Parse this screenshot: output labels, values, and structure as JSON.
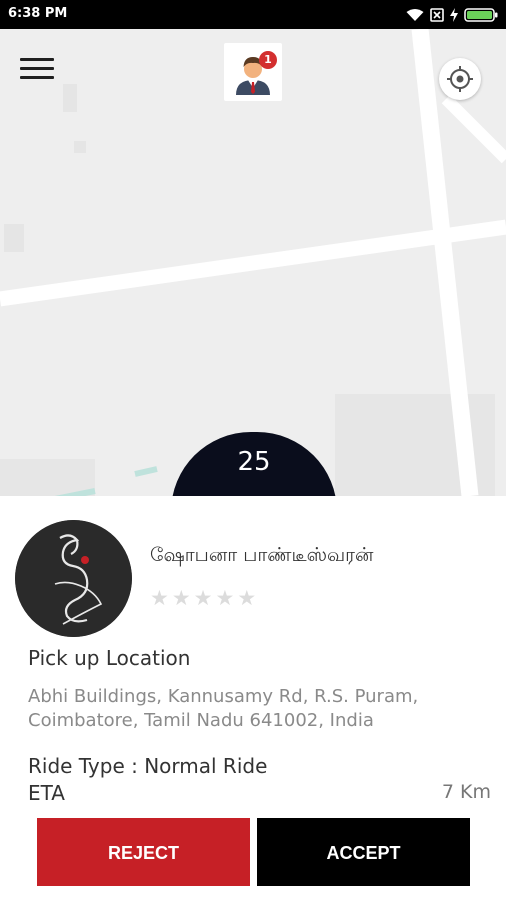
{
  "status_bar": {
    "time": "6:38 PM"
  },
  "header": {
    "notification_count": "1"
  },
  "timer": {
    "seconds": "25"
  },
  "rider": {
    "name": "ஷோபனா பாண்டீஸ்வரன்",
    "rating": 0,
    "max_rating": 5
  },
  "pickup": {
    "label": "Pick up Location",
    "address": "Abhi Buildings, Kannusamy Rd, R.S. Puram, Coimbatore, Tamil Nadu 641002, India"
  },
  "ride": {
    "type_label": "Ride Type : ",
    "type_value": "Normal Ride",
    "eta_label": "ETA",
    "eta_value": "7 Km"
  },
  "actions": {
    "reject_label": "REJECT",
    "accept_label": "ACCEPT"
  },
  "colors": {
    "reject": "#c62026",
    "accept": "#000000",
    "timer_bg": "#0a0d1c",
    "badge": "#d32f2f"
  }
}
